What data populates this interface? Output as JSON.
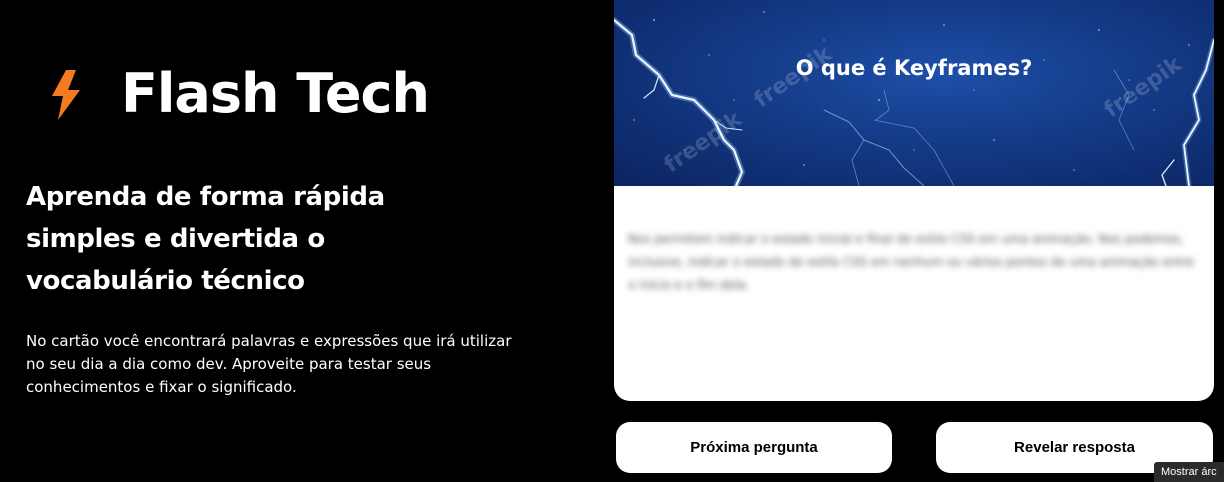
{
  "brand": {
    "name": "Flash Tech",
    "icon": "lightning-bolt-icon",
    "icon_color": "#f47b20"
  },
  "hero": {
    "headline": "Aprenda de forma rápida simples e divertida o vocabulário técnico",
    "description": "No cartão você encontrará palavras e expressões que irá utilizar no seu dia a dia como dev. Aproveite para testar seus conhecimentos e fixar o significado."
  },
  "card": {
    "question": "O que é Keyframes?",
    "answer": "Nos permitem indicar o estado inicial e final de estilo CSS em uma animação. Nos podemos, inclusive, indicar o estado de estilo CSS em nenhum ou vários pontos de uma animação entre o início e o fim dela.",
    "answer_hidden": true,
    "watermark": "freepik",
    "background_color": "#143a86"
  },
  "actions": {
    "next_label": "Próxima pergunta",
    "reveal_label": "Revelar resposta"
  },
  "tooltip": {
    "text": "Mostrar árc"
  }
}
